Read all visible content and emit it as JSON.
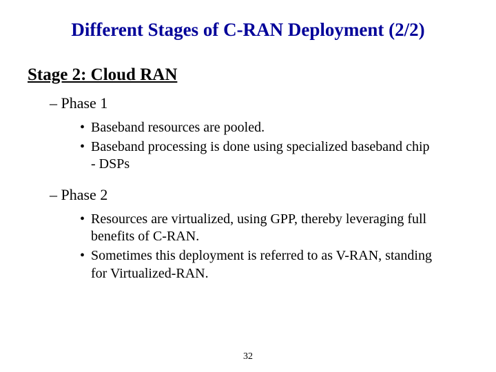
{
  "title": "Different Stages of C-RAN Deployment (2/2)",
  "stage_heading": "Stage 2: Cloud RAN",
  "phases": [
    {
      "label": "– Phase 1",
      "bullets": [
        "Baseband resources are pooled.",
        "Baseband processing is done using specialized baseband chip - DSPs"
      ]
    },
    {
      "label": "– Phase 2",
      "bullets": [
        "Resources are virtualized, using GPP, thereby leveraging full benefits of C-RAN.",
        "Sometimes this deployment is referred to as V-RAN, standing for Virtualized-RAN."
      ]
    }
  ],
  "page_number": "32"
}
